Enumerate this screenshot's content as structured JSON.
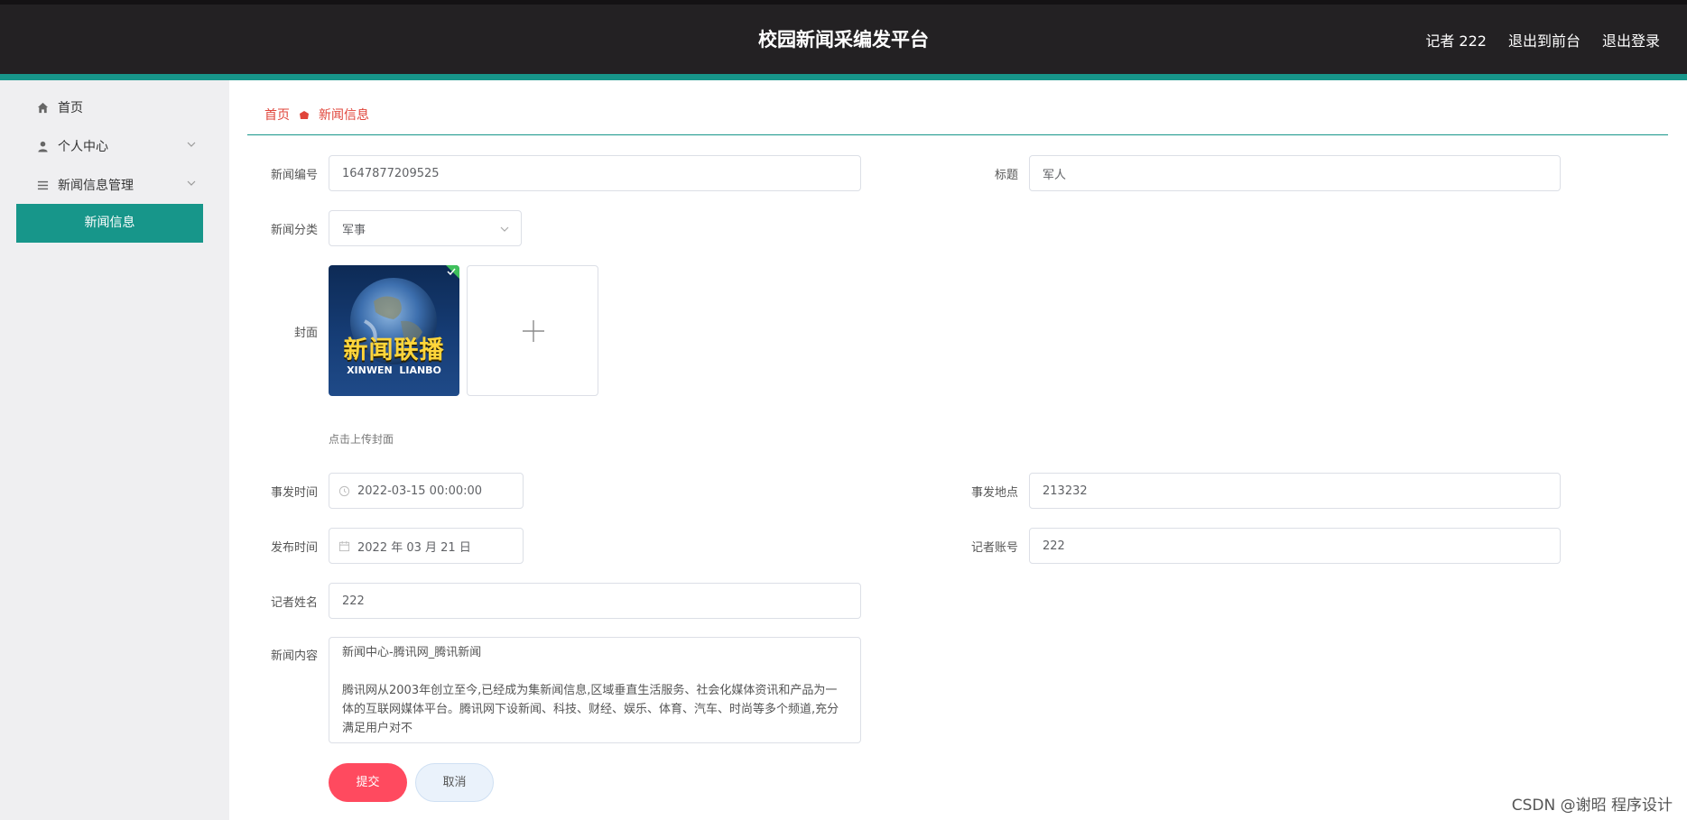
{
  "header": {
    "title": "校园新闻采编发平台",
    "user_label": "记者 222",
    "back_to_front": "退出到前台",
    "logout": "退出登录"
  },
  "sidebar": {
    "items": [
      {
        "label": "首页",
        "icon": "home-icon"
      },
      {
        "label": "个人中心",
        "icon": "user-icon"
      },
      {
        "label": "新闻信息管理",
        "icon": "list-icon"
      }
    ],
    "active_sub": "新闻信息"
  },
  "breadcrumb": {
    "home": "首页",
    "current": "新闻信息"
  },
  "form": {
    "news_no_label": "新闻编号",
    "news_no_value": "1647877209525",
    "title_label": "标题",
    "title_value": "军人",
    "category_label": "新闻分类",
    "category_value": "军事",
    "cover_label": "封面",
    "cover_text_cn": "新闻联播",
    "cover_text_en": "XINWEN  LIANBO",
    "cover_hint": "点击上传封面",
    "event_time_label": "事发时间",
    "event_time_value": "2022-03-15 00:00:00",
    "event_place_label": "事发地点",
    "event_place_value": "213232",
    "publish_time_label": "发布时间",
    "publish_time_value": "2022 年 03 月 21 日",
    "reporter_account_label": "记者账号",
    "reporter_account_value": "222",
    "reporter_name_label": "记者姓名",
    "reporter_name_value": "222",
    "content_label": "新闻内容",
    "content_value": "新闻中心-腾讯网_腾讯新闻\n\n腾讯网从2003年创立至今,已经成为集新闻信息,区域垂直生活服务、社会化媒体资讯和产品为一体的互联网媒体平台。腾讯网下设新闻、科技、财经、娱乐、体育、汽车、时尚等多个频道,充分满足用户对不",
    "submit": "提交",
    "cancel": "取消"
  },
  "watermark": "CSDN @谢昭  程序设计",
  "colors": {
    "header_bg": "#232123",
    "accent": "#17968a",
    "submit": "#ff4a5f",
    "breadcrumb": "#e0443a"
  }
}
